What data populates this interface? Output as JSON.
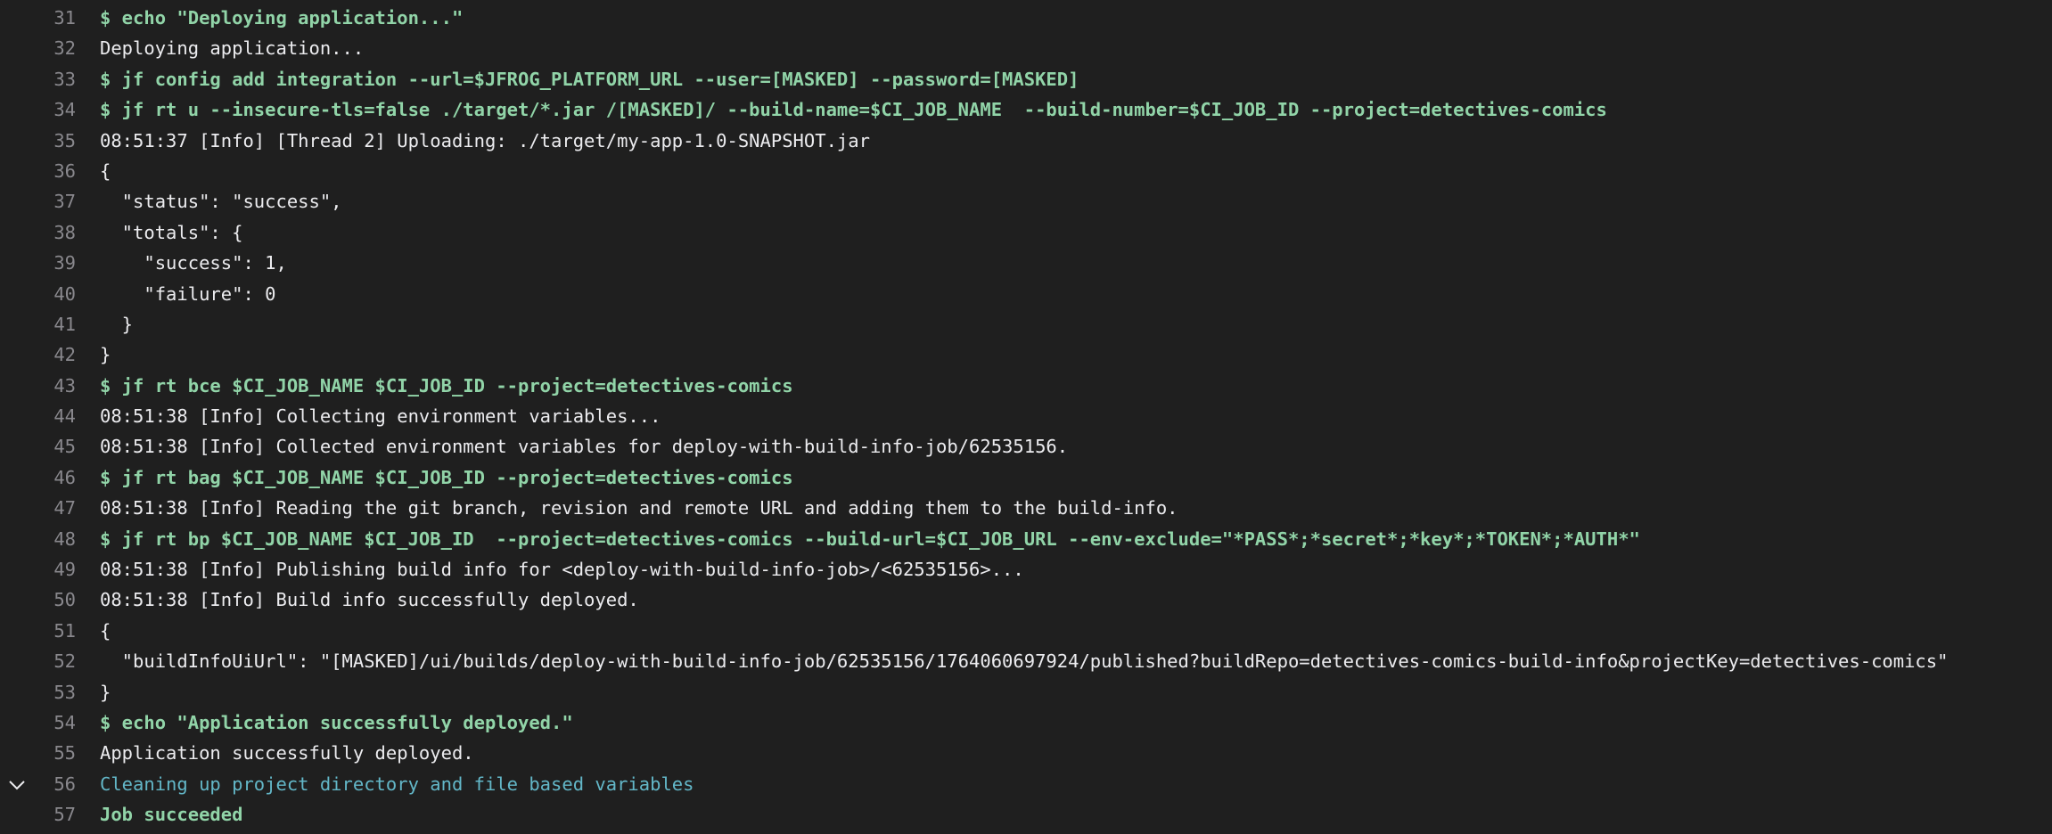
{
  "colors": {
    "background": "#1f1f1f",
    "line_number": "#89888d",
    "command": "#91d4a8",
    "output": "#ececef",
    "section": "#63b7c8"
  },
  "collapse_icon": "chevron-down-icon",
  "lines": [
    {
      "num": "31",
      "type": "cmd",
      "text": "$ echo \"Deploying application...\""
    },
    {
      "num": "32",
      "type": "out",
      "text": "Deploying application..."
    },
    {
      "num": "33",
      "type": "cmd",
      "text": "$ jf config add integration --url=$JFROG_PLATFORM_URL --user=[MASKED] --password=[MASKED]"
    },
    {
      "num": "34",
      "type": "cmd",
      "text": "$ jf rt u --insecure-tls=false ./target/*.jar /[MASKED]/ --build-name=$CI_JOB_NAME  --build-number=$CI_JOB_ID --project=detectives-comics"
    },
    {
      "num": "35",
      "type": "out",
      "text": "08:51:37 [Info] [Thread 2] Uploading: ./target/my-app-1.0-SNAPSHOT.jar"
    },
    {
      "num": "36",
      "type": "out",
      "text": "{"
    },
    {
      "num": "37",
      "type": "out",
      "text": "  \"status\": \"success\","
    },
    {
      "num": "38",
      "type": "out",
      "text": "  \"totals\": {"
    },
    {
      "num": "39",
      "type": "out",
      "text": "    \"success\": 1,"
    },
    {
      "num": "40",
      "type": "out",
      "text": "    \"failure\": 0"
    },
    {
      "num": "41",
      "type": "out",
      "text": "  }"
    },
    {
      "num": "42",
      "type": "out",
      "text": "}"
    },
    {
      "num": "43",
      "type": "cmd",
      "text": "$ jf rt bce $CI_JOB_NAME $CI_JOB_ID --project=detectives-comics"
    },
    {
      "num": "44",
      "type": "out",
      "text": "08:51:38 [Info] Collecting environment variables..."
    },
    {
      "num": "45",
      "type": "out",
      "text": "08:51:38 [Info] Collected environment variables for deploy-with-build-info-job/62535156."
    },
    {
      "num": "46",
      "type": "cmd",
      "text": "$ jf rt bag $CI_JOB_NAME $CI_JOB_ID --project=detectives-comics"
    },
    {
      "num": "47",
      "type": "out",
      "text": "08:51:38 [Info] Reading the git branch, revision and remote URL and adding them to the build-info."
    },
    {
      "num": "48",
      "type": "cmd",
      "text": "$ jf rt bp $CI_JOB_NAME $CI_JOB_ID  --project=detectives-comics --build-url=$CI_JOB_URL --env-exclude=\"*PASS*;*secret*;*key*;*TOKEN*;*AUTH*\""
    },
    {
      "num": "49",
      "type": "out",
      "text": "08:51:38 [Info] Publishing build info for <deploy-with-build-info-job>/<62535156>..."
    },
    {
      "num": "50",
      "type": "out",
      "text": "08:51:38 [Info] Build info successfully deployed."
    },
    {
      "num": "51",
      "type": "out",
      "text": "{"
    },
    {
      "num": "52",
      "type": "out",
      "text": "  \"buildInfoUiUrl\": \"[MASKED]/ui/builds/deploy-with-build-info-job/62535156/1764060697924/published?buildRepo=detectives-comics-build-info&projectKey=detectives-comics\""
    },
    {
      "num": "53",
      "type": "out",
      "text": "}"
    },
    {
      "num": "54",
      "type": "cmd",
      "text": "$ echo \"Application successfully deployed.\""
    },
    {
      "num": "55",
      "type": "out",
      "text": "Application successfully deployed."
    },
    {
      "num": "56",
      "type": "section",
      "text": "Cleaning up project directory and file based variables",
      "collapsible": true
    },
    {
      "num": "57",
      "type": "ok",
      "text": "Job succeeded"
    }
  ]
}
